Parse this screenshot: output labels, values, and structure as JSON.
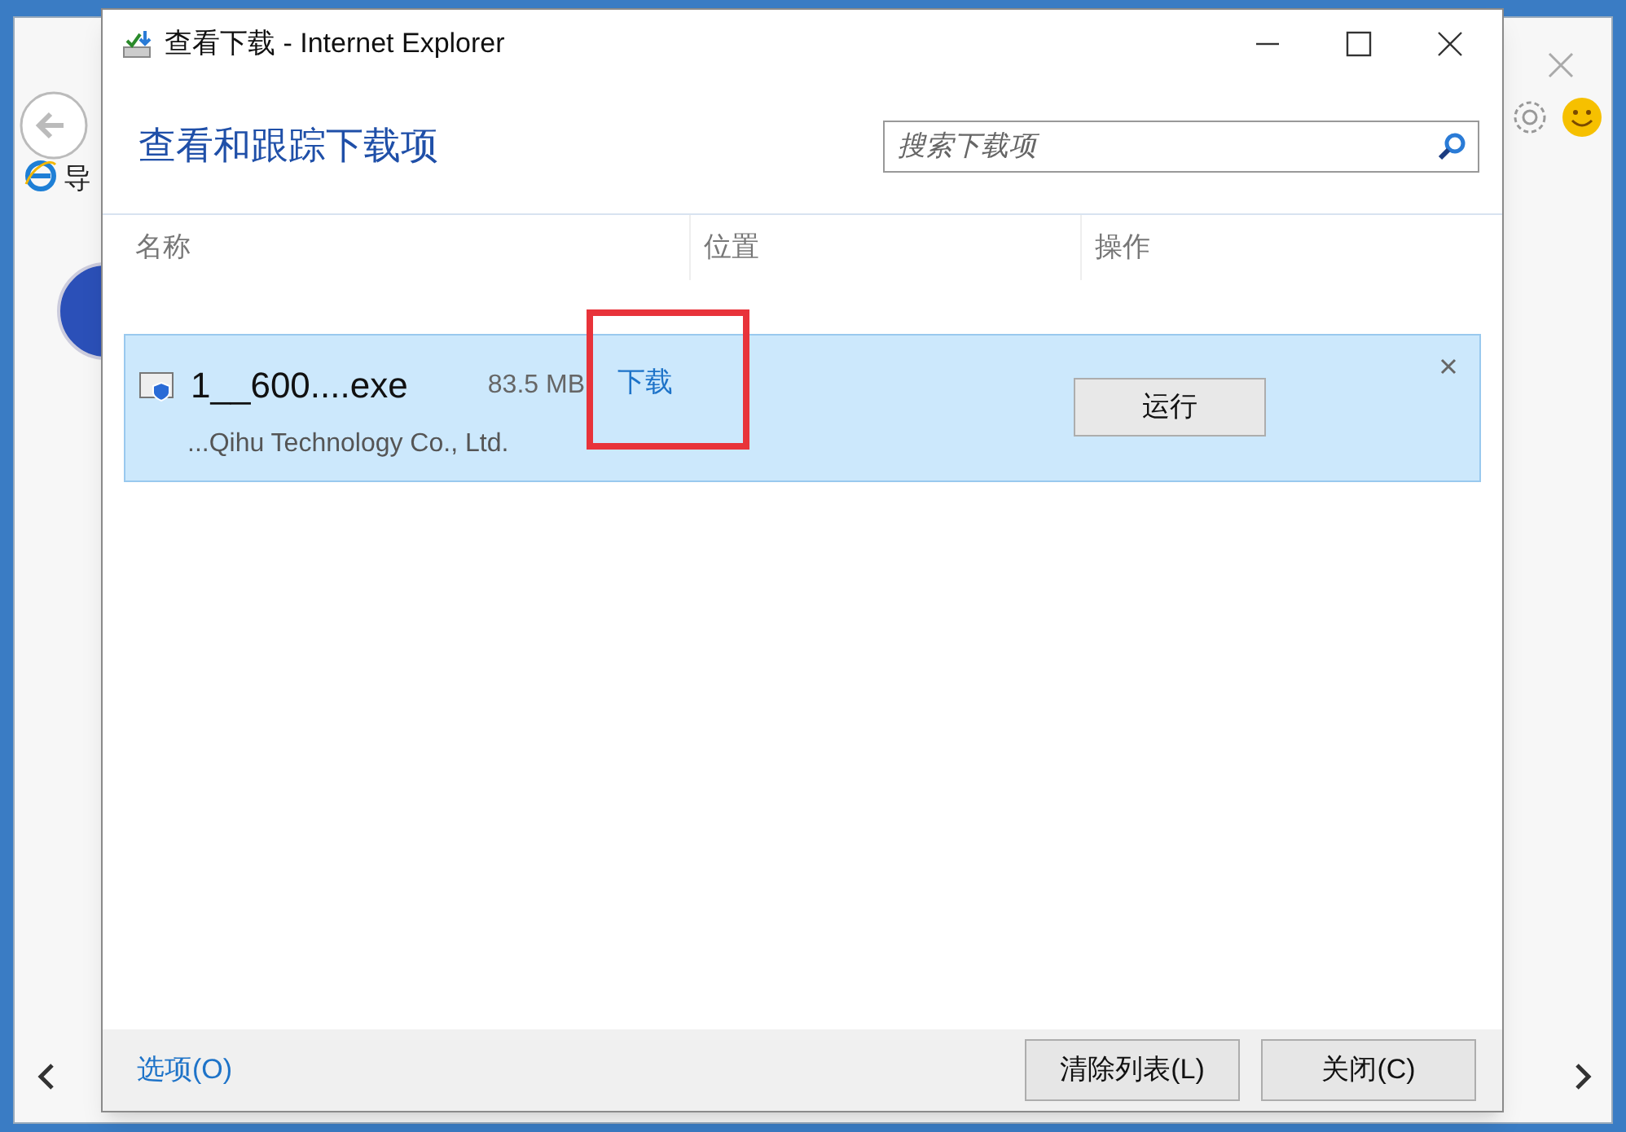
{
  "background_browser": {
    "tab_label": "导"
  },
  "window": {
    "title": "查看下载 - Internet Explorer"
  },
  "heading": "查看和跟踪下载项",
  "search": {
    "placeholder": "搜索下载项"
  },
  "columns": [
    "名称",
    "位置",
    "操作"
  ],
  "downloads": [
    {
      "name": "1__600....exe",
      "size": "83.5 MB",
      "publisher": "...Qihu Technology Co., Ltd.",
      "location": "下载",
      "action": "运行",
      "selected": true,
      "highlighted": true
    }
  ],
  "footer": {
    "options_link": "选项(O)",
    "buttons": [
      "清除列表(L)",
      "关闭(C)"
    ]
  }
}
